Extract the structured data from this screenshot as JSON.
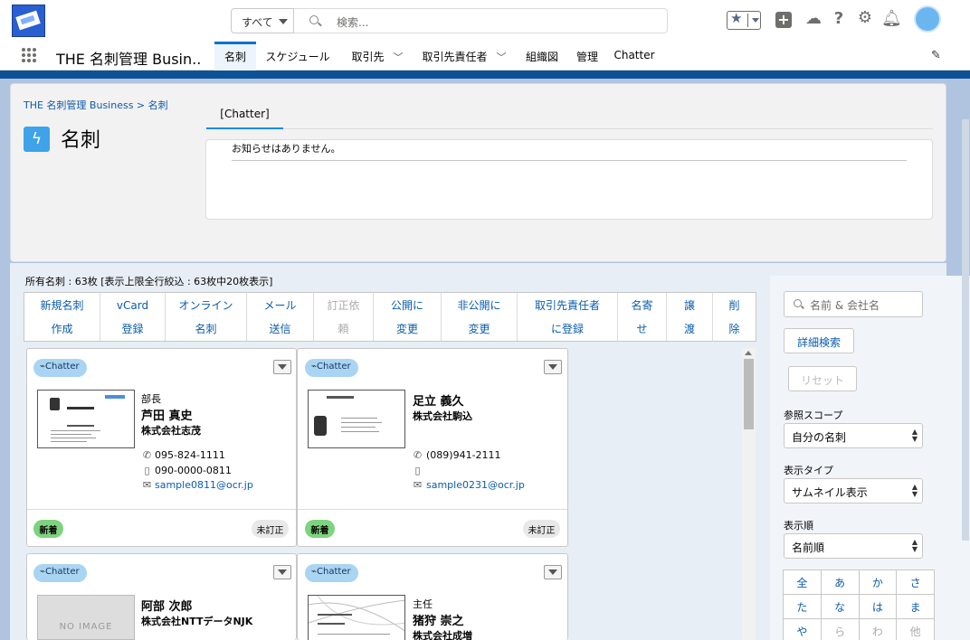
{
  "topbar": {
    "search_scope": "すべて",
    "search_placeholder": "検索..."
  },
  "nav": {
    "app_name": "THE 名刺管理 Busin...",
    "tabs": [
      "名刺",
      "スケジュール",
      "取引先",
      "取引先責任者",
      "組織図",
      "管理",
      "Chatter"
    ]
  },
  "header": {
    "breadcrumb": "THE 名刺管理 Business > 名刺",
    "title": "名刺",
    "chatter_tab": "[Chatter]",
    "notice": "お知らせはありません。"
  },
  "list": {
    "count_text": "所有名刺 : 63枚 [表示上限全行絞込 : 63枚中20枚表示]",
    "actions": [
      {
        "l1": "新規名刺",
        "l2": "作成",
        "disabled": false
      },
      {
        "l1": "vCard",
        "l2": "登録",
        "disabled": false
      },
      {
        "l1": "オンライン",
        "l2": "名刺",
        "disabled": false
      },
      {
        "l1": "メール",
        "l2": "送信",
        "disabled": false
      },
      {
        "l1": "訂正依",
        "l2": "頼",
        "disabled": true
      },
      {
        "l1": "公開に",
        "l2": "変更",
        "disabled": false
      },
      {
        "l1": "非公開に",
        "l2": "変更",
        "disabled": false
      },
      {
        "l1": "取引先責任者",
        "l2": "に登録",
        "disabled": false
      },
      {
        "l1": "名寄",
        "l2": "せ",
        "disabled": false
      },
      {
        "l1": "譲",
        "l2": "渡",
        "disabled": false
      },
      {
        "l1": "削",
        "l2": "除",
        "disabled": false
      }
    ],
    "cards": [
      {
        "chip": "Chatter",
        "title": "部長",
        "name": "芦田 真史",
        "company": "株式会社志茂",
        "tel": "095-824-1111",
        "mobile": "090-0000-0811",
        "email": "sample0811@ocr.jp",
        "new_label": "新着",
        "status": "未訂正"
      },
      {
        "chip": "Chatter",
        "title": "",
        "name": "足立 義久",
        "company": "株式会社駒込",
        "tel": "(089)941-2111",
        "mobile": "",
        "email": "sample0231@ocr.jp",
        "new_label": "新着",
        "status": "未訂正"
      },
      {
        "chip": "Chatter",
        "title": "",
        "name": "阿部 次郎",
        "company": "株式会社NTTデータNJK",
        "no_image": "NO IMAGE"
      },
      {
        "chip": "Chatter",
        "title": "主任",
        "name": "猪狩 崇之",
        "company": "株式会社成増"
      }
    ]
  },
  "sidebar": {
    "search_placeholder": "名前 & 会社名",
    "advanced_search": "詳細検索",
    "reset": "リセット",
    "scope_label": "参照スコープ",
    "scope_value": "自分の名刺",
    "type_label": "表示タイプ",
    "type_value": "サムネイル表示",
    "order_label": "表示順",
    "order_value": "名前順",
    "kana": [
      {
        "c": "全",
        "d": false
      },
      {
        "c": "あ",
        "d": false
      },
      {
        "c": "か",
        "d": false
      },
      {
        "c": "さ",
        "d": false
      },
      {
        "c": "た",
        "d": false
      },
      {
        "c": "な",
        "d": false
      },
      {
        "c": "は",
        "d": false
      },
      {
        "c": "ま",
        "d": false
      },
      {
        "c": "や",
        "d": false
      },
      {
        "c": "ら",
        "d": true
      },
      {
        "c": "わ",
        "d": true
      },
      {
        "c": "他",
        "d": true
      }
    ]
  }
}
